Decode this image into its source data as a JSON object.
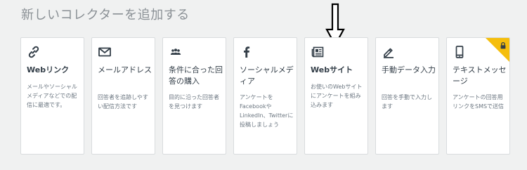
{
  "page": {
    "title": "新しいコレクターを追加する"
  },
  "cards": [
    {
      "id": "weblink",
      "icon": "link-icon",
      "title": "Webリンク",
      "description": "メールやソーシャルメディアなどでの配信に最適です。"
    },
    {
      "id": "email",
      "icon": "envelope-icon",
      "title": "メールアドレス",
      "description": "回答者を追跡しやすい配信方法です"
    },
    {
      "id": "panel",
      "icon": "group-icon",
      "title": "条件に合った回答の購入",
      "description": "目的に沿った回答者を見つけます"
    },
    {
      "id": "social",
      "icon": "facebook-icon",
      "title": "ソーシャルメディア",
      "description": "アンケートをFacebookやLinkedIn、Twitterに投稿しましょう"
    },
    {
      "id": "website",
      "icon": "newspaper-icon",
      "title": "Webサイト",
      "description": "お使いのWebサイトにアンケートを組み込みます"
    },
    {
      "id": "manual",
      "icon": "pencil-icon",
      "title": "手動データ入力",
      "description": "回答を手動で入力します"
    },
    {
      "id": "sms",
      "icon": "mobile-phone-icon",
      "title": "テキストメッセージ",
      "description": "アンケートの回答用リンクをSMSで送信",
      "locked": true
    }
  ],
  "colors": {
    "background": "#f0f1f1",
    "card": "#ffffff",
    "icon": "#333e48",
    "lock_badge": "#f5be0c"
  }
}
